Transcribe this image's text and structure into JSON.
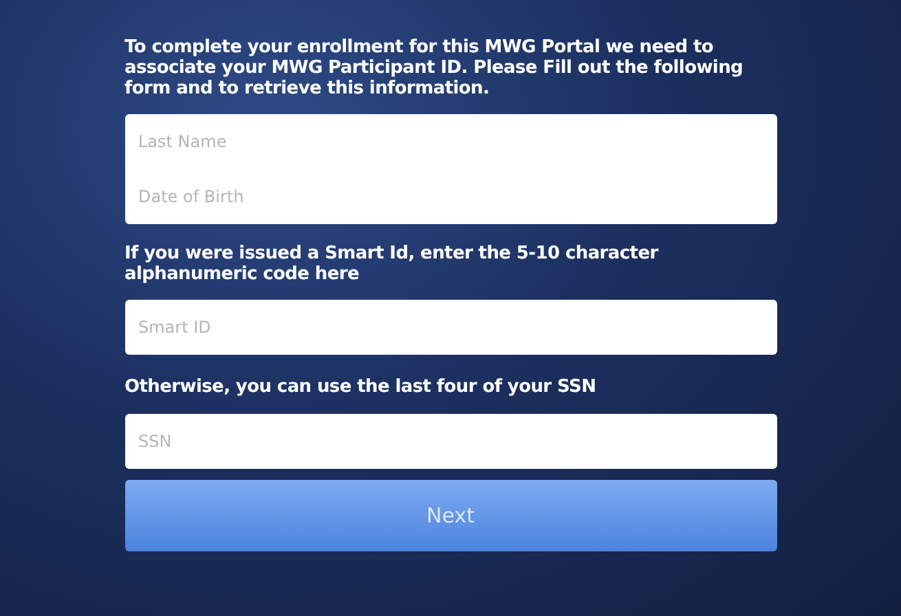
{
  "intro": "To complete your enrollment for this MWG Portal we need to associate your MWG Participant ID. Please Fill out the following form and to retrieve this information.",
  "identity_fields": [
    {
      "placeholder": "Last Name"
    },
    {
      "placeholder": "Date of Birth"
    }
  ],
  "smart_id_label": "If you were issued a Smart Id, enter the 5-10 character alphanumeric code here",
  "smart_id_field": {
    "placeholder": "Smart ID"
  },
  "ssn_label": "Otherwise, you can use the last four of your SSN",
  "ssn_field": {
    "placeholder": "SSN"
  },
  "next_button": "Next"
}
